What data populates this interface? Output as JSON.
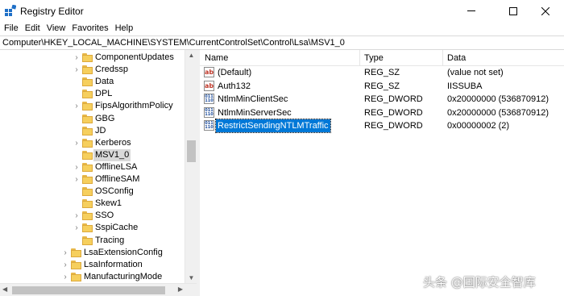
{
  "window": {
    "title": "Registry Editor",
    "icon": "registry-editor-icon"
  },
  "menu": [
    "File",
    "Edit",
    "View",
    "Favorites",
    "Help"
  ],
  "address": "Computer\\HKEY_LOCAL_MACHINE\\SYSTEM\\CurrentControlSet\\Control\\Lsa\\MSV1_0",
  "tree": {
    "items": [
      {
        "label": "ComponentUpdates",
        "expandable": true,
        "level": 2
      },
      {
        "label": "Credssp",
        "expandable": true,
        "level": 2
      },
      {
        "label": "Data",
        "expandable": false,
        "level": 2
      },
      {
        "label": "DPL",
        "expandable": false,
        "level": 2
      },
      {
        "label": "FipsAlgorithmPolicy",
        "expandable": true,
        "level": 2
      },
      {
        "label": "GBG",
        "expandable": false,
        "level": 2
      },
      {
        "label": "JD",
        "expandable": false,
        "level": 2
      },
      {
        "label": "Kerberos",
        "expandable": true,
        "level": 2
      },
      {
        "label": "MSV1_0",
        "expandable": false,
        "level": 2,
        "selected": true
      },
      {
        "label": "OfflineLSA",
        "expandable": true,
        "level": 2
      },
      {
        "label": "OfflineSAM",
        "expandable": true,
        "level": 2
      },
      {
        "label": "OSConfig",
        "expandable": false,
        "level": 2
      },
      {
        "label": "Skew1",
        "expandable": false,
        "level": 2
      },
      {
        "label": "SSO",
        "expandable": true,
        "level": 2
      },
      {
        "label": "SspiCache",
        "expandable": true,
        "level": 2
      },
      {
        "label": "Tracing",
        "expandable": false,
        "level": 2
      },
      {
        "label": "LsaExtensionConfig",
        "expandable": true,
        "level": 1
      },
      {
        "label": "LsaInformation",
        "expandable": true,
        "level": 1
      },
      {
        "label": "ManufacturingMode",
        "expandable": true,
        "level": 1
      }
    ]
  },
  "list": {
    "columns": {
      "name": "Name",
      "type": "Type",
      "data": "Data"
    },
    "rows": [
      {
        "name": "(Default)",
        "type": "REG_SZ",
        "data": "(value not set)",
        "icon": "string-value-icon",
        "selected": false
      },
      {
        "name": "Auth132",
        "type": "REG_SZ",
        "data": "IISSUBA",
        "icon": "string-value-icon",
        "selected": false
      },
      {
        "name": "NtlmMinClientSec",
        "type": "REG_DWORD",
        "data": "0x20000000 (536870912)",
        "icon": "dword-value-icon",
        "selected": false
      },
      {
        "name": "NtlmMinServerSec",
        "type": "REG_DWORD",
        "data": "0x20000000 (536870912)",
        "icon": "dword-value-icon",
        "selected": false
      },
      {
        "name": "RestrictSendingNTLMTraffic",
        "type": "REG_DWORD",
        "data": "0x00000002 (2)",
        "icon": "dword-value-icon",
        "selected": true
      }
    ]
  },
  "icons": {
    "sz_glyph": "ab",
    "dword_glyph": "011\n110"
  },
  "watermark": "头条 @国际安全智库",
  "colors": {
    "selection_blue": "#0078d7",
    "folder_yellow": "#f6cf5d"
  }
}
